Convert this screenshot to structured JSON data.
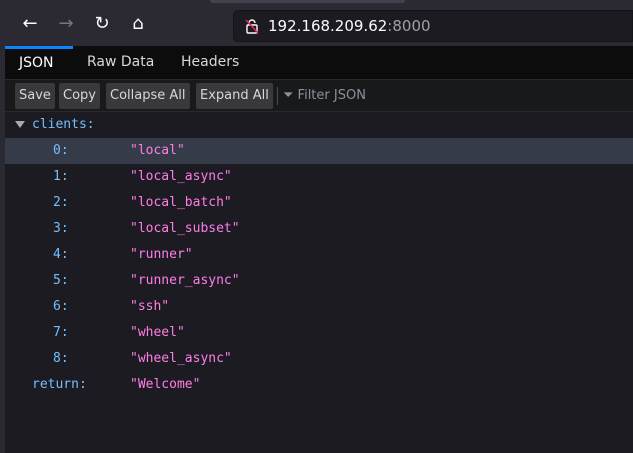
{
  "browser": {
    "url_host": "192.168.209.62",
    "url_port": ":8000"
  },
  "tabs": [
    {
      "label": "JSON"
    },
    {
      "label": "Raw Data"
    },
    {
      "label": "Headers"
    }
  ],
  "toolbar": {
    "save": "Save",
    "copy": "Copy",
    "collapse_all": "Collapse All",
    "expand_all": "Expand All",
    "filter_placeholder": "Filter JSON"
  },
  "json": {
    "clients_key": "clients:",
    "clients": [
      {
        "index": "0:",
        "value": "\"local\""
      },
      {
        "index": "1:",
        "value": "\"local_async\""
      },
      {
        "index": "2:",
        "value": "\"local_batch\""
      },
      {
        "index": "3:",
        "value": "\"local_subset\""
      },
      {
        "index": "4:",
        "value": "\"runner\""
      },
      {
        "index": "5:",
        "value": "\"runner_async\""
      },
      {
        "index": "6:",
        "value": "\"ssh\""
      },
      {
        "index": "7:",
        "value": "\"wheel\""
      },
      {
        "index": "8:",
        "value": "\"wheel_async\""
      }
    ],
    "return_key": "return:",
    "return_value": "\"Welcome\""
  }
}
